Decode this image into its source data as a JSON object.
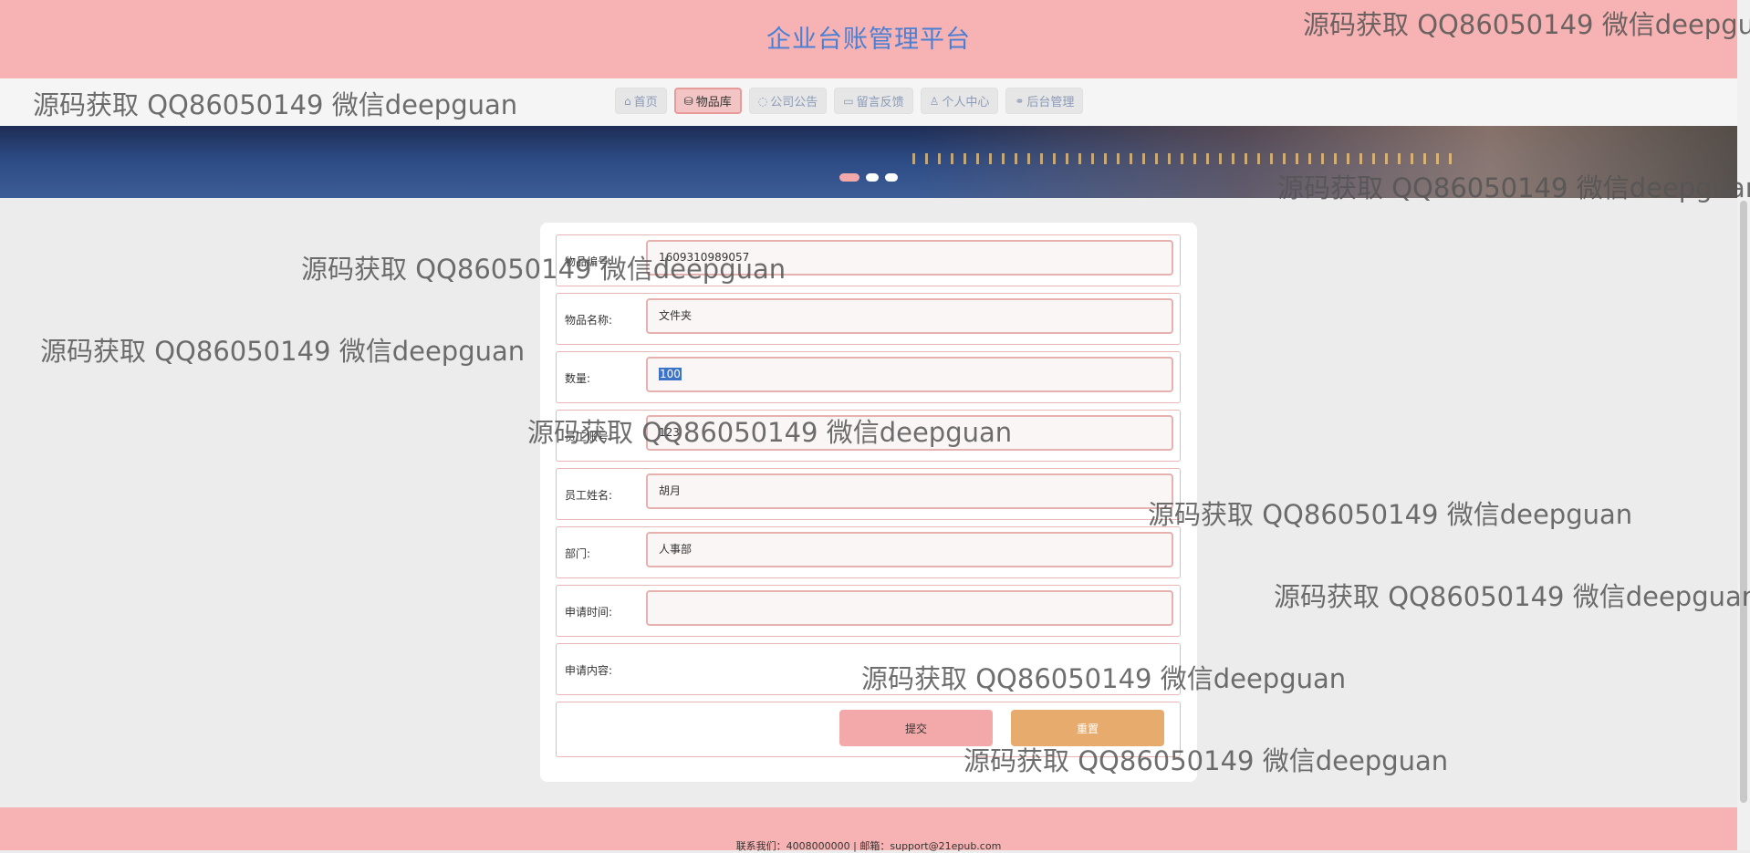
{
  "header": {
    "title": "企业台账管理平台"
  },
  "nav": {
    "items": [
      {
        "icon": "home-icon",
        "label": "首页",
        "active": false
      },
      {
        "icon": "database-icon",
        "label": "物品库",
        "active": true
      },
      {
        "icon": "chat-icon",
        "label": "公司公告",
        "active": false
      },
      {
        "icon": "edit-icon",
        "label": "留言反馈",
        "active": false
      },
      {
        "icon": "user-icon",
        "label": "个人中心",
        "active": false
      },
      {
        "icon": "link-icon",
        "label": "后台管理",
        "active": false
      }
    ]
  },
  "banner": {
    "slides": 3,
    "active_slide": 1
  },
  "form": {
    "fields": [
      {
        "label": "物品编号:",
        "value": "1609310989057"
      },
      {
        "label": "物品名称:",
        "value": "文件夹"
      },
      {
        "label": "数量:",
        "value": "100"
      },
      {
        "label": "员工账号:",
        "value": "123"
      },
      {
        "label": "员工姓名:",
        "value": "胡月"
      },
      {
        "label": "部门:",
        "value": "人事部"
      },
      {
        "label": "申请时间:",
        "value": ""
      },
      {
        "label": "申请内容:",
        "value": ""
      }
    ],
    "submit_label": "提交",
    "reset_label": "重置"
  },
  "footer": {
    "text": "联系我们：4008000000 | 邮箱：support@21epub.com"
  },
  "watermarks": {
    "text": "源码获取 QQ86050149 微信deepguan"
  },
  "colors": {
    "header_bg": "#f7b3b3",
    "title": "#4a7fd3",
    "submit": "#f3a9a9",
    "reset": "#e7ab6d"
  }
}
